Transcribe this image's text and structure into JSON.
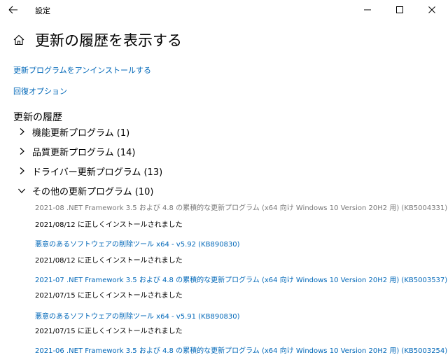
{
  "window": {
    "title": "設定"
  },
  "header": {
    "title": "更新の履歴を表示する"
  },
  "links": [
    {
      "label": "更新プログラムをアンインストールする"
    },
    {
      "label": "回復オプション"
    }
  ],
  "history": {
    "section_title": "更新の履歴",
    "categories": [
      {
        "label": "機能更新プログラム (1)",
        "expanded": false
      },
      {
        "label": "品質更新プログラム (14)",
        "expanded": false
      },
      {
        "label": "ドライバー更新プログラム (13)",
        "expanded": false
      },
      {
        "label": "その他の更新プログラム (10)",
        "expanded": true
      }
    ],
    "updates": [
      {
        "title": "2021-08 .NET Framework 3.5 および 4.8 の累積的な更新プログラム (x64 向け Windows 10 Version 20H2 用) (KB5004331)",
        "status": "2021/08/12 に正しくインストールされました"
      },
      {
        "title": "悪意のあるソフトウェアの削除ツール x64 - v5.92 (KB890830)",
        "status": "2021/08/12 に正しくインストールされました"
      },
      {
        "title": "2021-07 .NET Framework 3.5 および 4.8 の累積的な更新プログラム (x64 向け Windows 10 Version 20H2 用) (KB5003537)",
        "status": "2021/07/15 に正しくインストールされました"
      },
      {
        "title": "悪意のあるソフトウェアの削除ツール x64 - v5.91 (KB890830)",
        "status": "2021/07/15 に正しくインストールされました"
      },
      {
        "title": "2021-06 .NET Framework 3.5 および 4.8 の累積的な更新プログラム (x64 向け Windows 10 Version 20H2 用) (KB5003254)",
        "status": ""
      }
    ]
  },
  "colors": {
    "accent": "#0067b8",
    "visited_gray": "#7a7a7a"
  }
}
